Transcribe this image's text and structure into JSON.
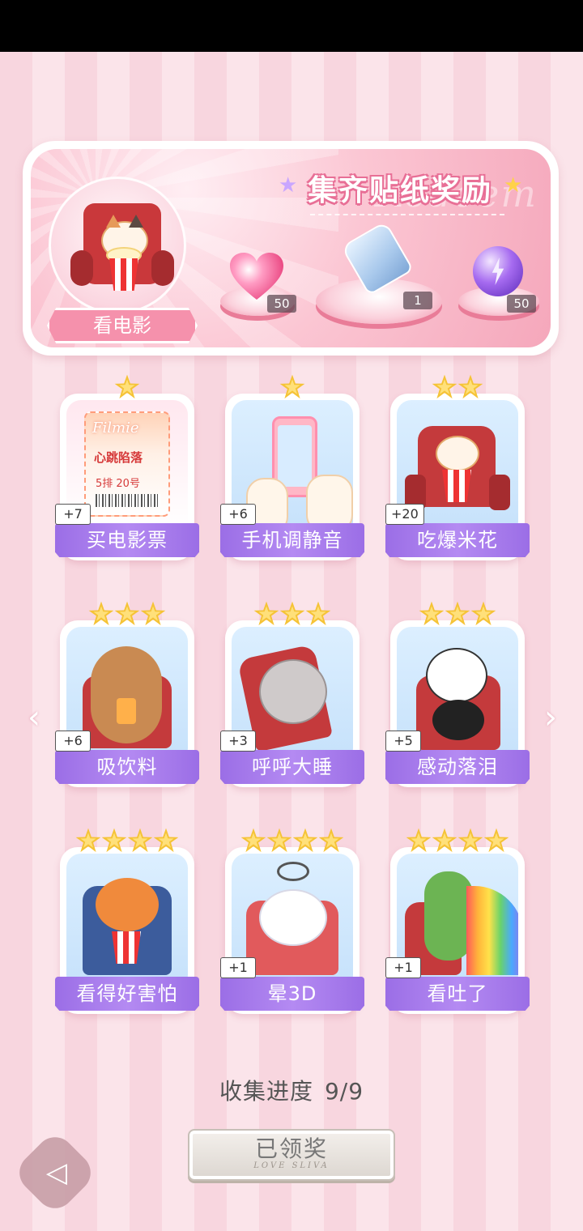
{
  "banner": {
    "title": "集齐贴纸奖励",
    "watermark": "Redeem",
    "theme_label": "看电影",
    "rewards": [
      {
        "icon": "pink-heart-gem-icon",
        "count": "50"
      },
      {
        "icon": "wish-bottle-icon",
        "count": "1"
      },
      {
        "icon": "purple-lightning-orb-icon",
        "count": "50"
      }
    ]
  },
  "stickers": [
    {
      "label": "买电影票",
      "stars": 1,
      "bonus": "+7"
    },
    {
      "label": "手机调静音",
      "stars": 1,
      "bonus": "+6"
    },
    {
      "label": "吃爆米花",
      "stars": 2,
      "bonus": "+20"
    },
    {
      "label": "吸饮料",
      "stars": 3,
      "bonus": "+6"
    },
    {
      "label": "呼呼大睡",
      "stars": 3,
      "bonus": "+3"
    },
    {
      "label": "感动落泪",
      "stars": 3,
      "bonus": "+5"
    },
    {
      "label": "看得好害怕",
      "stars": 4,
      "bonus": ""
    },
    {
      "label": "晕3D",
      "stars": 4,
      "bonus": "+1"
    },
    {
      "label": "看吐了",
      "stars": 4,
      "bonus": "+1"
    }
  ],
  "ticket": {
    "brand": "Filmie",
    "title": "心跳陷落",
    "seat": "5排 20号"
  },
  "progress": {
    "label": "收集进度",
    "value": "9/9"
  },
  "claim_button": {
    "label": "已领奖",
    "sub": "LOVE SLIVA"
  },
  "nav": {
    "left": "‹",
    "right": "›"
  },
  "colors": {
    "accent_purple": "#9b6ee6",
    "pink": "#f591ac",
    "star": "#f5c336"
  }
}
